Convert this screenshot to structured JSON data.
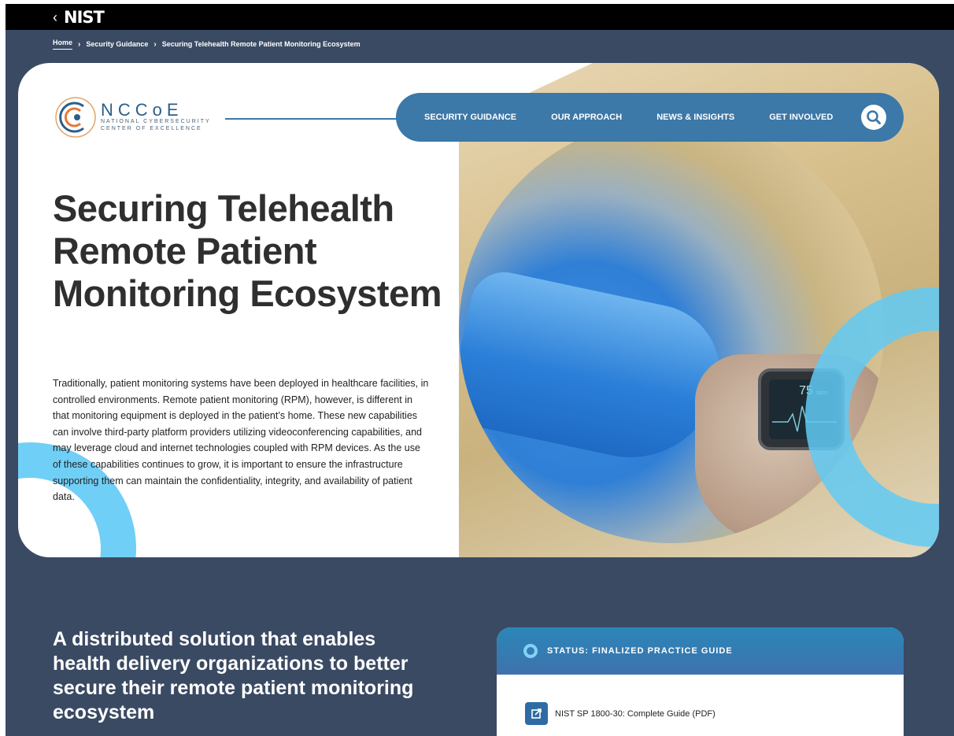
{
  "nist_bar": {
    "back_glyph": "‹",
    "logo_text": "NIST"
  },
  "breadcrumb": {
    "items": [
      "Home",
      "Security Guidance",
      "Securing Telehealth Remote Patient Monitoring Ecosystem"
    ]
  },
  "logo": {
    "acronym": "NCCoE",
    "line1": "NATIONAL CYBERSECURITY",
    "line2": "CENTER OF EXCELLENCE"
  },
  "nav": {
    "items": [
      "SECURITY GUIDANCE",
      "OUR APPROACH",
      "NEWS & INSIGHTS",
      "GET INVOLVED"
    ],
    "search_icon": "search-icon"
  },
  "hero": {
    "title": "Securing Telehealth Remote Patient Monitoring Ecosystem",
    "description": "Traditionally, patient monitoring systems have been deployed in healthcare facilities, in controlled environments. Remote patient monitoring (RPM), however, is different in that monitoring equipment is deployed in the patient’s home. These new capabilities can involve third-party platform providers utilizing videoconferencing capabilities, and may leverage cloud and internet technologies coupled with RPM devices. As the use of these capabilities continues to grow, it is important to ensure the infrastructure supporting them can maintain the confidentiality, integrity, and availability of patient data.",
    "watch_reading": "75",
    "watch_unit": "bpm"
  },
  "section": {
    "title": "A distributed solution that enables health delivery organizations to better secure their remote patient monitoring ecosystem"
  },
  "status": {
    "label": "STATUS: FINALIZED PRACTICE GUIDE",
    "doc_link": "NIST SP 1800-30: Complete Guide (PDF)",
    "doc_icon": "external-link-icon"
  },
  "colors": {
    "page_bg": "#3a4a63",
    "nav_bg": "#3c78a8",
    "accent_cyan": "#60caf5",
    "title_text": "#2f2f2f"
  }
}
